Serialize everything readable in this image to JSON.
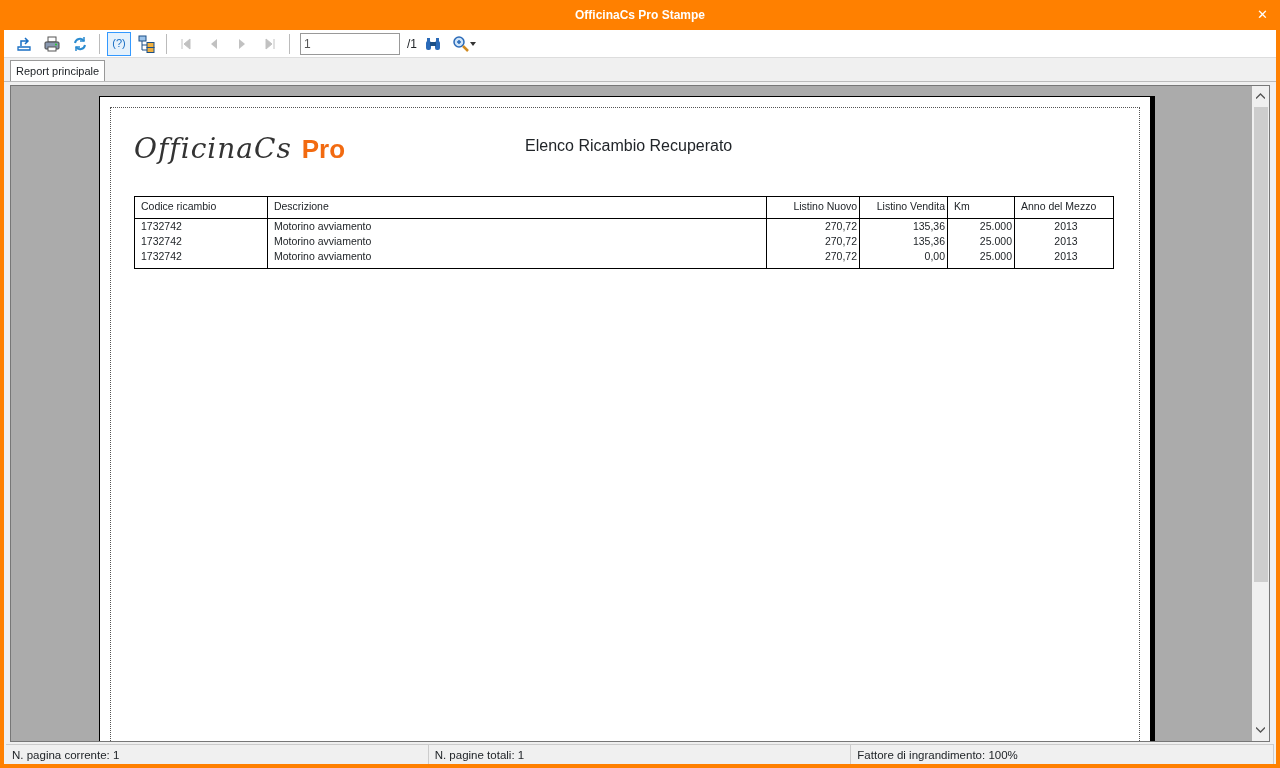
{
  "window": {
    "title": "OfficinaCs Pro Stampe",
    "close": "✕"
  },
  "toolbar": [
    {
      "kind": "icon",
      "disabled": false
    },
    {
      "kind": "icon",
      "disabled": false
    },
    {
      "kind": "icon",
      "disabled": false
    },
    {
      "kind": "sep"
    },
    {
      "kind": "toggle",
      "label": "(?)",
      "selected": true
    },
    {
      "kind": "icon",
      "disabled": false
    },
    {
      "kind": "sep"
    },
    {
      "kind": "icon",
      "disabled": true
    },
    {
      "kind": "icon",
      "disabled": true
    },
    {
      "kind": "icon",
      "disabled": true
    },
    {
      "kind": "icon",
      "disabled": true
    },
    {
      "kind": "sep"
    },
    {
      "kind": "page",
      "value": "1",
      "total": "/1"
    },
    {
      "kind": "icon",
      "disabled": false
    },
    {
      "kind": "icon",
      "disabled": false
    }
  ],
  "tabs": [
    {
      "label": "Report principale",
      "selected": true
    }
  ],
  "report": {
    "logo": {
      "script": "OfficinaCs",
      "accent": "Pro"
    },
    "title": "Elenco Ricambio Recuperato",
    "columns": [
      "Codice ricambio",
      "Descrizione",
      "Listino Nuovo",
      "Listino Vendita",
      "Km",
      "Anno del Mezzo"
    ],
    "rows": [
      [
        "1732742",
        "Motorino avviamento",
        "270,72",
        "135,36",
        "25.000",
        "2013"
      ],
      [
        "1732742",
        "Motorino avviamento",
        "270,72",
        "135,36",
        "25.000",
        "2013"
      ],
      [
        "1732742",
        "Motorino avviamento",
        "270,72",
        "0,00",
        "25.000",
        "2013"
      ]
    ]
  },
  "status_bar": [
    "N. pagina corrente: 1",
    "N. pagine totali: 1",
    "Fattore di ingrandimento: 100%"
  ]
}
